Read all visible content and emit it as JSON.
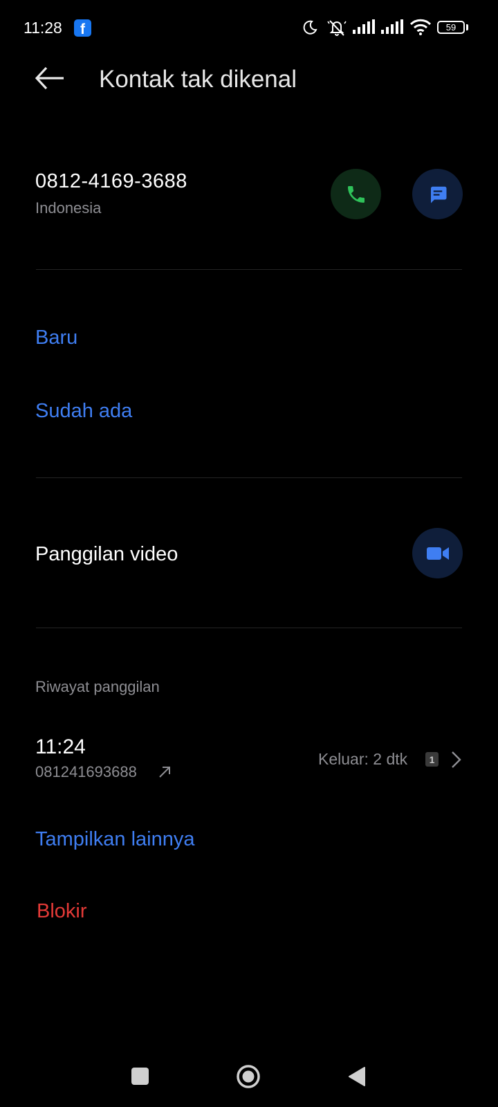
{
  "status_bar": {
    "time": "11:28",
    "notification_app": "f",
    "battery_level": "59",
    "icons": [
      "facebook-icon",
      "moon-icon",
      "mute-icon",
      "signal-icon",
      "signal-icon",
      "wifi-icon",
      "battery-icon"
    ]
  },
  "header": {
    "back_icon": "arrow-left-icon",
    "title": "Kontak tak dikenal"
  },
  "contact": {
    "phone_number": "0812-4169-3688",
    "country": "Indonesia",
    "call_icon": "phone-icon",
    "message_icon": "message-icon"
  },
  "add_contact": {
    "new_label": "Baru",
    "existing_label": "Sudah ada"
  },
  "video_call": {
    "label": "Panggilan video",
    "icon": "video-camera-icon"
  },
  "call_history": {
    "section_title": "Riwayat panggilan",
    "entries": [
      {
        "time": "11:24",
        "number": "081241693688",
        "direction_icon": "outgoing-arrow-icon",
        "duration": "Keluar: 2 dtk",
        "sim": "1"
      }
    ],
    "show_more_label": "Tampilkan lainnya"
  },
  "block_label": "Blokir",
  "colors": {
    "accent_blue": "#3f7ef2",
    "danger_red": "#e43a37",
    "call_green": "#2fc25a",
    "background": "#000000"
  }
}
